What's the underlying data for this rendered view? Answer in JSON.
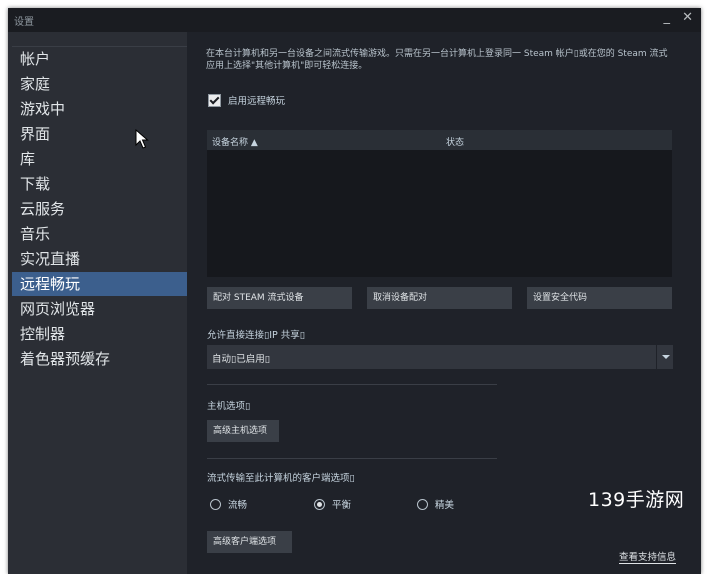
{
  "window": {
    "title": "设置",
    "minimize_glyph": "_",
    "close_glyph": "✕"
  },
  "sidebar": {
    "items": [
      {
        "label": "帐户",
        "active": false
      },
      {
        "label": "家庭",
        "active": false
      },
      {
        "label": "游戏中",
        "active": false
      },
      {
        "label": "界面",
        "active": false
      },
      {
        "label": "库",
        "active": false
      },
      {
        "label": "下载",
        "active": false
      },
      {
        "label": "云服务",
        "active": false
      },
      {
        "label": "音乐",
        "active": false
      },
      {
        "label": "实况直播",
        "active": false
      },
      {
        "label": "远程畅玩",
        "active": true
      },
      {
        "label": "网页浏览器",
        "active": false
      },
      {
        "label": "控制器",
        "active": false
      },
      {
        "label": "着色器预缓存",
        "active": false
      }
    ]
  },
  "content": {
    "intro": "在本台计算机和另一台设备之间流式传输游戏。只需在另一台计算机上登录同一 Steam 帐户▯或在您的 Steam 流式应用上选择\"其他计算机\"即可轻松连接。",
    "enable_remote_play": {
      "label": "启用远程畅玩",
      "checked": true
    },
    "device_table": {
      "col_name": "设备名称 ▲",
      "col_status": "状态",
      "rows": []
    },
    "buttons": {
      "pair_steam": "配对 STEAM 流式设备",
      "cancel_pair": "取消设备配对",
      "set_security_code": "设置安全代码"
    },
    "direct_connection": {
      "label": "允许直接连接▯IP 共享▯",
      "dropdown_value": "自动▯已启用▯"
    },
    "host_options": {
      "label": "主机选项▯",
      "advanced_host_button": "高级主机选项"
    },
    "client_options": {
      "label": "流式传输至此计算机的客户端选项▯",
      "radios": [
        {
          "label": "流畅",
          "selected": false
        },
        {
          "label": "平衡",
          "selected": true
        },
        {
          "label": "精美",
          "selected": false
        }
      ],
      "advanced_client_button": "高级客户端选项"
    },
    "support_link": "查看支持信息"
  },
  "watermark": "139手游网",
  "colors": {
    "accent": "#3c5f8d",
    "sidebar_bg": "#2b2e35",
    "content_bg": "#1f2229"
  }
}
